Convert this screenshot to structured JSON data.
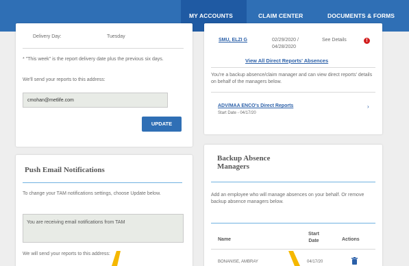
{
  "nav": {
    "my_accounts": "MY ACCOUNTS",
    "claim_center": "CLAIM CENTER",
    "documents_forms": "DOCUMENTS & FORMS"
  },
  "delivery": {
    "day_label": "Delivery Day:",
    "day_value": "Tuesday",
    "note": "* \"This week\" is the report delivery date plus the previous six days.",
    "send_text": "We'll send your reports to this address:",
    "email": "cmohan@metlife.com",
    "update_label": "UPDATE"
  },
  "push": {
    "title": "Push Email Notifications",
    "instructions": "To change your TAM notifications settings, choose Update below.",
    "status": "You are receiving email notifications from TAM",
    "send_text": "We will send your reports to this address:"
  },
  "reports": {
    "name": "SMU, ELZI G",
    "dates": "02/29/2020 / 04/28/2020",
    "see_details": "See Details",
    "view_all": "View All Direct Reports' Absences",
    "backup_text": "You're a backup absence/claim manager and can view direct reports' details on behalf of the managers below.",
    "manager_link": "ADV/MAA ENCO's Direct Reports",
    "start_date": "Start Date - 04/17/20"
  },
  "backup": {
    "title": "Backup Absence Managers",
    "description": "Add an employee who will manage absences on your behalf. Or remove backup absence managers below.",
    "col_name": "Name",
    "col_start": "Start Date",
    "col_actions": "Actions",
    "row_name": "BONANISE, AMBRAY",
    "row_date": "04/17/20"
  },
  "colors": {
    "nav": "#2f6fb5",
    "accent_rule": "#6fb1e0",
    "alert": "#d21f1f",
    "annotation": "#f5b800"
  }
}
